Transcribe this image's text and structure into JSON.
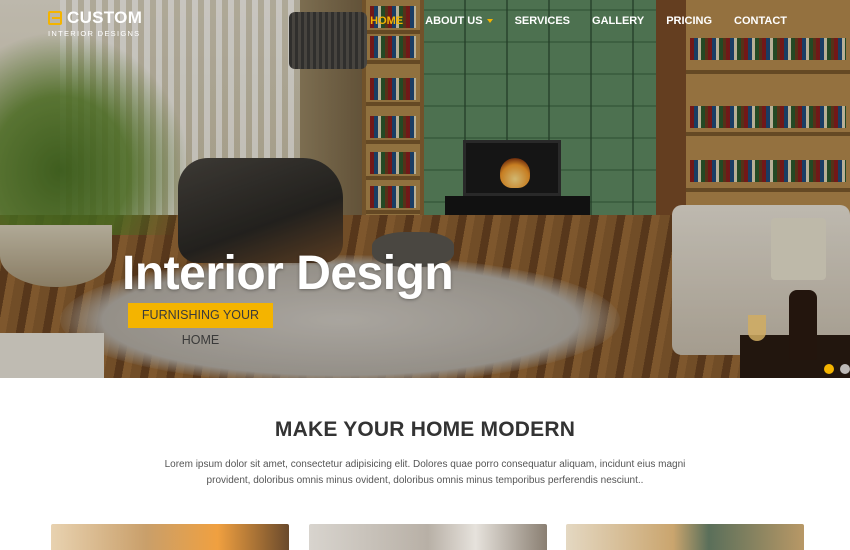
{
  "header": {
    "logo_name": "CUSTOM",
    "logo_tagline": "INTERIOR DESIGNS",
    "logo_icon": "sign-in-icon"
  },
  "nav": {
    "items": [
      {
        "label": "HOME",
        "active": true
      },
      {
        "label": "ABOUT US",
        "active": false,
        "has_dropdown": true
      },
      {
        "label": "SERVICES",
        "active": false
      },
      {
        "label": "GALLERY",
        "active": false
      },
      {
        "label": "PRICING",
        "active": false
      },
      {
        "label": "CONTACT",
        "active": false
      }
    ]
  },
  "hero": {
    "title": "Interior Design",
    "button_label": "FURNISHING YOUR HOME",
    "slides_count": 2,
    "active_slide": 1
  },
  "intro": {
    "title": "MAKE YOUR HOME MODERN",
    "text": "Lorem ipsum dolor sit amet, consectetur adipisicing elit. Dolores quae porro consequatur aliquam, incidunt eius magni provident, doloribus omnis minus ovident, doloribus omnis minus temporibus perferendis nesciunt.."
  },
  "colors": {
    "accent": "#f4b400",
    "text_dark": "#333333",
    "text_body": "#555555"
  }
}
